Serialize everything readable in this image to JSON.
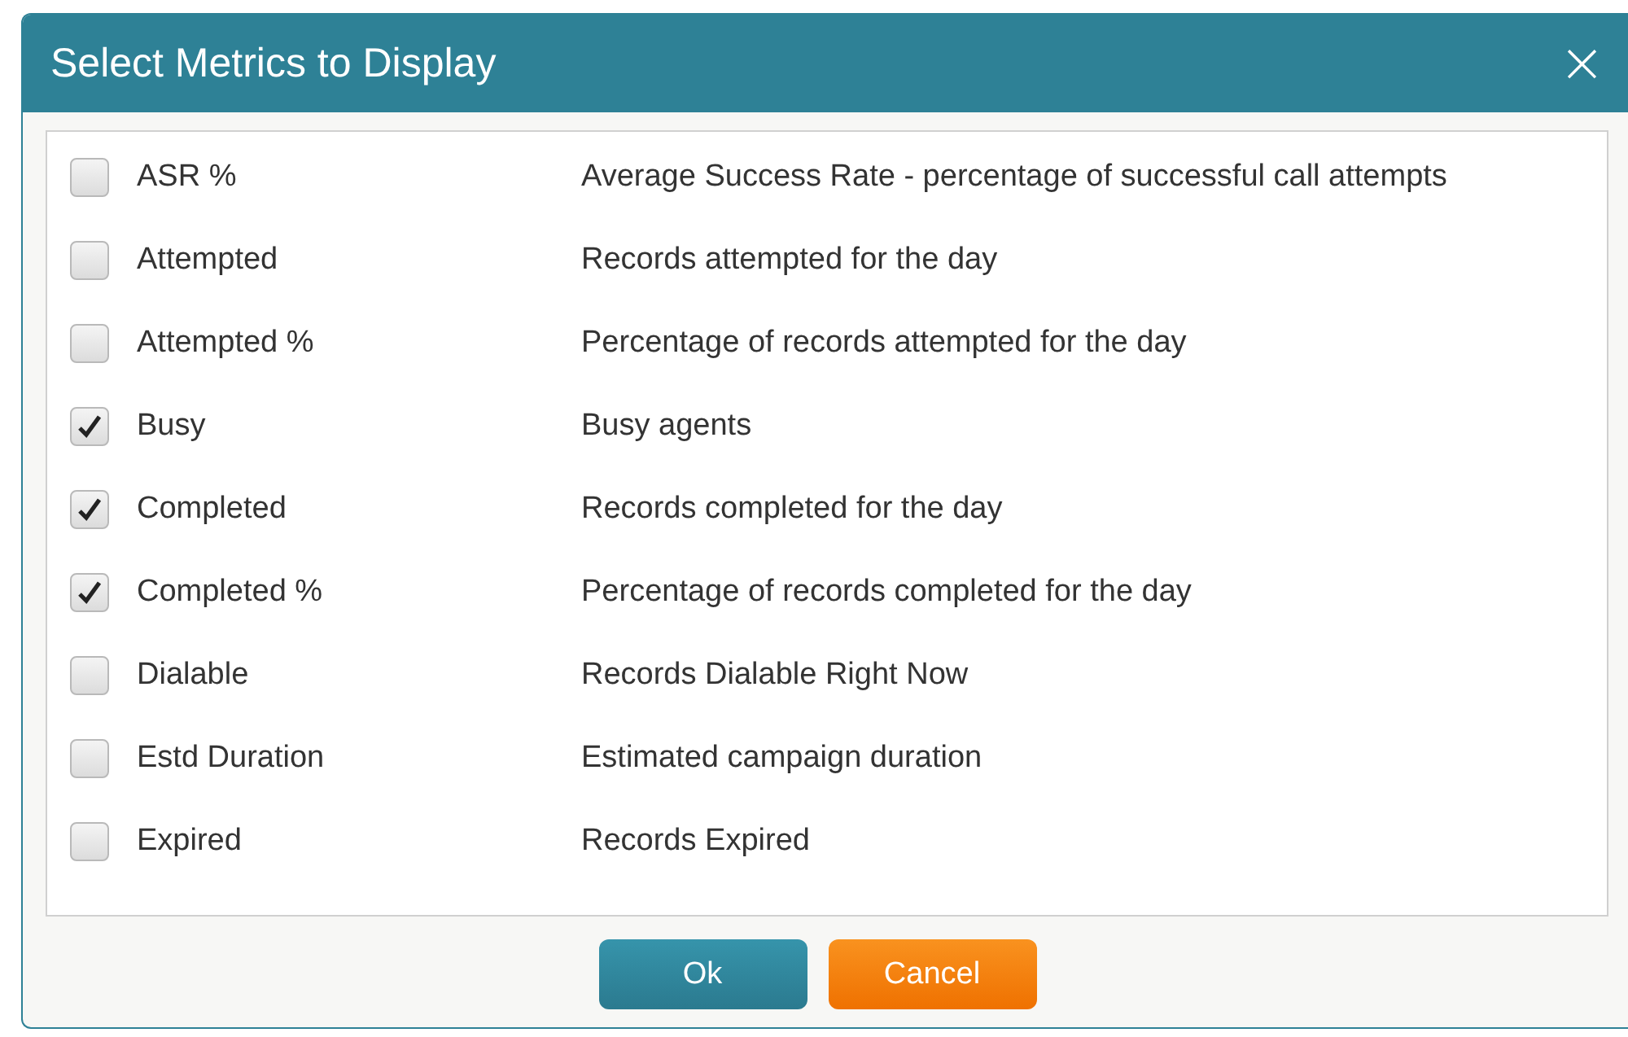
{
  "dialog": {
    "title": "Select Metrics to Display",
    "close_icon": "×"
  },
  "metrics": [
    {
      "name": "ASR %",
      "description": "Average Success Rate - percentage of successful call attempts",
      "checked": false
    },
    {
      "name": "Attempted",
      "description": "Records attempted for the day",
      "checked": false
    },
    {
      "name": "Attempted %",
      "description": "Percentage of records attempted for the day",
      "checked": false
    },
    {
      "name": "Busy",
      "description": "Busy agents",
      "checked": true
    },
    {
      "name": "Completed",
      "description": "Records completed for the day",
      "checked": true
    },
    {
      "name": "Completed %",
      "description": "Percentage of records completed for the day",
      "checked": true
    },
    {
      "name": "Dialable",
      "description": "Records Dialable Right Now",
      "checked": false
    },
    {
      "name": "Estd Duration",
      "description": "Estimated campaign duration",
      "checked": false
    },
    {
      "name": "Expired",
      "description": "Records Expired",
      "checked": false
    }
  ],
  "buttons": [
    {
      "label": "Ok",
      "kind": "primary"
    },
    {
      "label": "Cancel",
      "kind": "secondary"
    }
  ]
}
